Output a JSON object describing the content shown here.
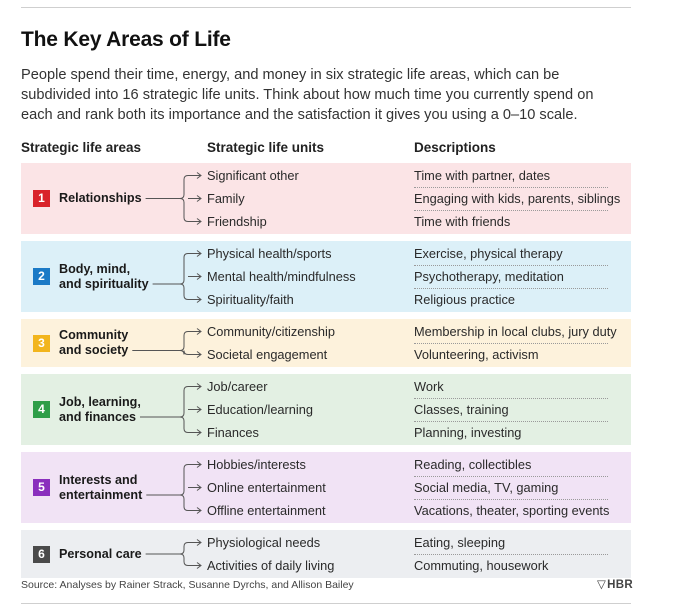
{
  "title": "The Key Areas of Life",
  "intro": "People spend their time, energy, and money in six strategic life areas, which can be subdivided into 16 strategic life units. Think about how much time you currently spend on each and rank both its importance and the satisfaction it gives you using a 0–10 scale.",
  "headers": {
    "areas": "Strategic life areas",
    "units": "Strategic life units",
    "descriptions": "Descriptions"
  },
  "areas": [
    {
      "number": "1",
      "name_lines": [
        "Relationships"
      ],
      "color": "#d9222a",
      "bg": "#fbe4e6",
      "units": [
        {
          "unit": "Significant other",
          "description": "Time with partner, dates"
        },
        {
          "unit": "Family",
          "description": "Engaging with kids, parents, siblings"
        },
        {
          "unit": "Friendship",
          "description": "Time with friends"
        }
      ]
    },
    {
      "number": "2",
      "name_lines": [
        "Body, mind,",
        "and spirituality"
      ],
      "color": "#1b7ac6",
      "bg": "#dcf0f8",
      "units": [
        {
          "unit": "Physical health/sports",
          "description": "Exercise, physical therapy"
        },
        {
          "unit": "Mental health/mindfulness",
          "description": "Psychotherapy, meditation"
        },
        {
          "unit": "Spirituality/faith",
          "description": "Religious practice"
        }
      ]
    },
    {
      "number": "3",
      "name_lines": [
        "Community",
        "and society"
      ],
      "color": "#f2b51d",
      "bg": "#fdf2dc",
      "units": [
        {
          "unit": "Community/citizenship",
          "description": "Membership in local clubs, jury duty"
        },
        {
          "unit": "Societal engagement",
          "description": "Volunteering, activism"
        }
      ]
    },
    {
      "number": "4",
      "name_lines": [
        "Job, learning,",
        "and finances"
      ],
      "color": "#2e9e48",
      "bg": "#e3f0e3",
      "units": [
        {
          "unit": "Job/career",
          "description": "Work"
        },
        {
          "unit": "Education/learning",
          "description": "Classes, training"
        },
        {
          "unit": "Finances",
          "description": "Planning, investing"
        }
      ]
    },
    {
      "number": "5",
      "name_lines": [
        "Interests and",
        "entertainment"
      ],
      "color": "#8a2fbd",
      "bg": "#f1e3f5",
      "units": [
        {
          "unit": "Hobbies/interests",
          "description": "Reading, collectibles"
        },
        {
          "unit": "Online entertainment",
          "description": "Social media, TV, gaming"
        },
        {
          "unit": "Offline entertainment",
          "description": "Vacations, theater, sporting events"
        }
      ]
    },
    {
      "number": "6",
      "name_lines": [
        "Personal care"
      ],
      "color": "#4a4a4a",
      "bg": "#eceef1",
      "units": [
        {
          "unit": "Physiological needs",
          "description": "Eating, sleeping"
        },
        {
          "unit": "Activities of daily living",
          "description": "Commuting, housework"
        }
      ]
    }
  ],
  "source": "Source: Analyses by Rainer Strack, Susanne Dyrchs, and Allison Bailey",
  "logo": "HBR"
}
